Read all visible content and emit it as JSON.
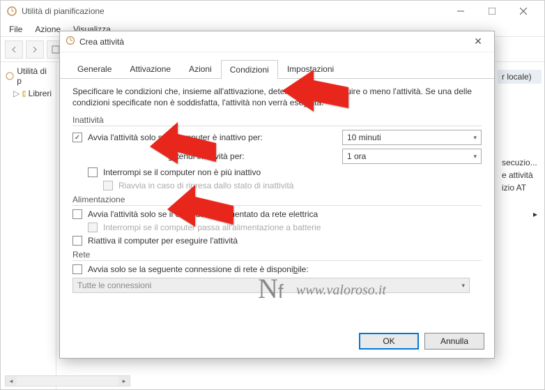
{
  "main_window": {
    "title": "Utilità di pianificazione",
    "menu": {
      "file": "File",
      "azione": "Azione",
      "visualizza": "Visualizza"
    },
    "nav": {
      "root": "Utilità di p",
      "child": "Libreri"
    },
    "right": {
      "header": "r locale)",
      "items": [
        "secuzio...",
        "e attività",
        "izio AT"
      ]
    }
  },
  "dialog": {
    "title": "Crea attività",
    "tabs": {
      "generale": "Generale",
      "attivazione": "Attivazione",
      "azioni": "Azioni",
      "condizioni": "Condizioni",
      "impostazioni": "Impostazioni"
    },
    "descr": "Specificare le condizioni che, insieme all'attivazione, determinano se eseguire o meno l'attività. Se una delle condizioni specificate non è soddisfatta, l'attività non verrà eseguita.",
    "groups": {
      "inattivita": "Inattività",
      "alimentazione": "Alimentazione",
      "rete": "Rete"
    },
    "fields": {
      "idle_start": "Avvia l'attività solo se il computer è inattivo per:",
      "idle_wait": "Attendi inattività per:",
      "idle_stop": "Interrompi se il computer non è più inattivo",
      "idle_resume": "Riavvia in caso di ripresa dallo stato di inattività",
      "power_ac": "Avvia l'attività solo se il computer è alimentato da rete elettrica",
      "power_battery": "Interrompi se il computer passa all'alimentazione a batterie",
      "power_wake": "Riattiva il computer per eseguire l'attività",
      "net_start": "Avvia solo se la seguente connessione di rete è disponibile:"
    },
    "values": {
      "idle_time": "10 minuti",
      "idle_wait_time": "1 ora",
      "net_conn": "Tutte le connessioni"
    },
    "buttons": {
      "ok": "OK",
      "cancel": "Annulla"
    }
  },
  "watermark": "www.valoroso.it"
}
